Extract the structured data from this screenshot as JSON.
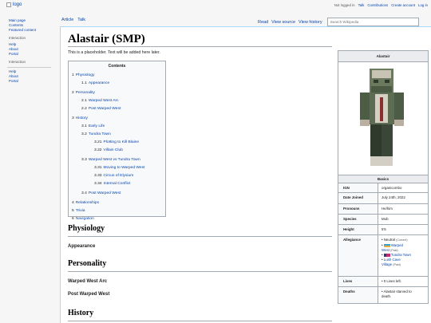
{
  "logo": {
    "alt": "logo"
  },
  "personal": {
    "not_logged_in": "Not logged in",
    "talk": "Talk",
    "contributions": "Contributions",
    "create_account": "Create account",
    "log_in": "Log in"
  },
  "sidebar": {
    "main_page": "Main page",
    "contents": "Contents",
    "featured": "Featured content",
    "interaction1": "Interaction",
    "help1": "Help",
    "about1": "About",
    "portal1": "Portal",
    "interaction2": "Interaction",
    "help2": "Help",
    "about2": "About",
    "portal2": "Portal"
  },
  "tabs": {
    "article": "Article",
    "talk": "Talk",
    "read": "Read",
    "view_source": "View source",
    "view_history": "View history"
  },
  "search": {
    "placeholder": "Search Wikipedia"
  },
  "page": {
    "title": "Alastair (SMP)",
    "intro": "This is a placeholder. Text will be added here later."
  },
  "toc": {
    "title": "Contents",
    "items": [
      {
        "num": "1",
        "label": "Physiology"
      },
      {
        "num": "1.1",
        "label": "Appearance"
      },
      {
        "num": "2",
        "label": "Personality"
      },
      {
        "num": "2.1",
        "label": "Warped West Arc"
      },
      {
        "num": "2.2",
        "label": "Post Warped West"
      },
      {
        "num": "3",
        "label": "History"
      },
      {
        "num": "3.1",
        "label": "Early Life"
      },
      {
        "num": "3.2",
        "label": "Tundra Town"
      },
      {
        "num": "3.21",
        "label": "Plotting to Kill Blaine"
      },
      {
        "num": "3.22",
        "label": "Villain Club"
      },
      {
        "num": "3.3",
        "label": "Warped West vs Tundra Town"
      },
      {
        "num": "3.31",
        "label": "Moving to Warped West"
      },
      {
        "num": "3.33",
        "label": "Circus of Elysium"
      },
      {
        "num": "3.34",
        "label": "Internal Conflict"
      },
      {
        "num": "3.4",
        "label": "Post Warped West"
      },
      {
        "num": "4",
        "label": "Relationships"
      },
      {
        "num": "5",
        "label": "Trivia"
      },
      {
        "num": "6",
        "label": "Navigation"
      }
    ]
  },
  "sections": {
    "physiology": "Physiology",
    "appearance": "Appearance",
    "personality": "Personality",
    "warped_west_arc": "Warped West Arc",
    "post_warped_west": "Post Warped West",
    "history": "History"
  },
  "infobox": {
    "title": "Alastair",
    "basics": "Basics",
    "rows": {
      "ign_key": "IGN",
      "ign_val": "organicombo",
      "joined_key": "Date Joined",
      "joined_val": "July 24th, 2022",
      "pronouns_key": "Pronouns",
      "pronouns_val": "He/him",
      "species_key": "Species",
      "species_val": "Mob",
      "height_key": "Height",
      "height_val": "5'5",
      "allegiance_key": "Allegiance",
      "allegiance": {
        "neutral": "Neutral",
        "current": "(Current)",
        "warped": "Warped",
        "west": "West",
        "past1": "(Past)",
        "tundra": "Tundra Town",
        "lush": "Lush Cave",
        "village": "Village",
        "past2": "(Past)"
      },
      "lives_key": "Lives",
      "lives_val": "0 Lives left.",
      "deaths_key": "Deaths",
      "deaths_val": "Alastair starved to",
      "deaths_val2": "death."
    }
  },
  "colors": {
    "link": "#0645ad",
    "border": "#a2a9b1",
    "accent_rule": "#a7d7f9"
  }
}
